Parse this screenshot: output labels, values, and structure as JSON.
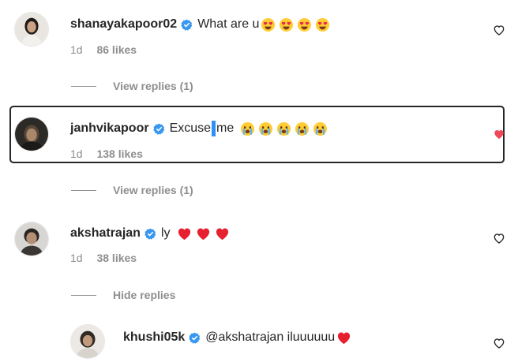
{
  "comments": [
    {
      "username": "shanayakapoor02",
      "text": "What are u",
      "emojis": [
        "heart-eyes",
        "heart-eyes",
        "heart-eyes",
        "heart-eyes"
      ],
      "age": "1d",
      "likes": "86 likes",
      "replies_label": "View replies (1)"
    },
    {
      "username": "janhvikapoor",
      "text_before_cursor": "Excuse",
      "text_after_cursor": "me",
      "emojis": [
        "crying-face",
        "crying-face",
        "crying-face",
        "crying-face",
        "crying-face"
      ],
      "age": "1d",
      "likes": "138 likes",
      "replies_label": "View replies (1)",
      "liked": true
    },
    {
      "username": "akshatrajan",
      "text": "ly",
      "emojis": [
        "red-heart",
        "red-heart",
        "red-heart"
      ],
      "age": "1d",
      "likes": "38 likes",
      "replies_label": "Hide replies"
    },
    {
      "username": "khushi05k",
      "text": "@akshatrajan iluuuuuu",
      "emojis": [
        "red-heart"
      ]
    }
  ],
  "colors": {
    "verified_badge": "#3897f0",
    "liked_heart": "#ed4956",
    "muted_text": "#8e8e8e",
    "cursor": "#2f8ff8"
  }
}
